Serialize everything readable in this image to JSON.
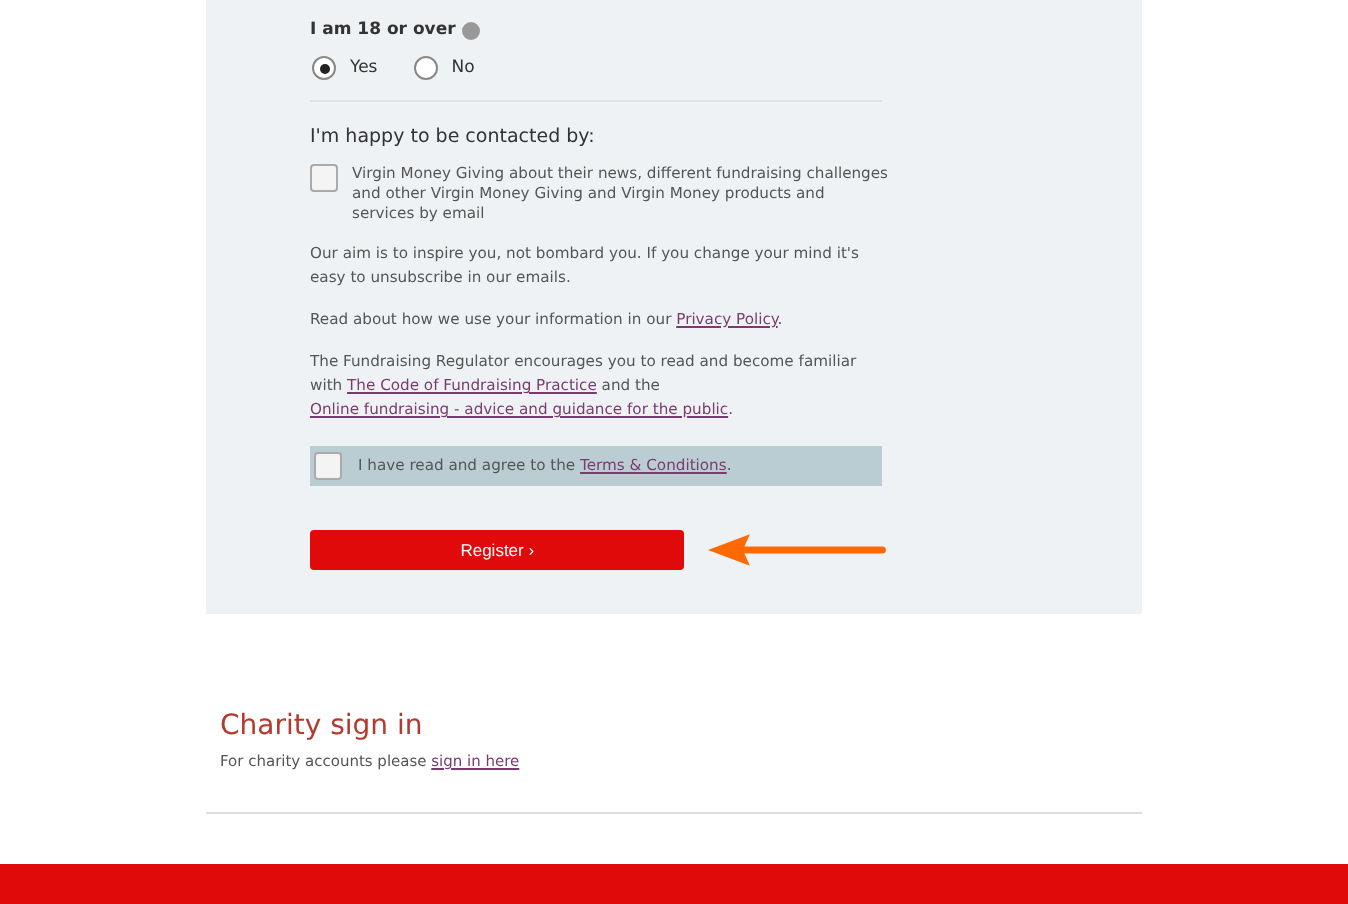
{
  "age_question": {
    "label": "I am 18 or over",
    "options": [
      {
        "label": "Yes",
        "selected": true
      },
      {
        "label": "No",
        "selected": false
      }
    ]
  },
  "contact": {
    "heading": "I'm happy to be contacted by:",
    "options": [
      {
        "label": "Virgin Money Giving about their news, different fundraising challenges and other Virgin Money Giving and Virgin Money products and services by email",
        "checked": false
      }
    ]
  },
  "paragraphs": [
    [
      {
        "kind": "text",
        "text": "Our aim is to inspire you, not bombard you. If you change your mind it's easy to unsubscribe in our emails."
      }
    ],
    [
      {
        "kind": "text",
        "text": "Read about how we use your information in our "
      },
      {
        "kind": "link",
        "text": "Privacy Policy"
      },
      {
        "kind": "text",
        "text": "."
      }
    ],
    [
      {
        "kind": "text",
        "text": "The Fundraising Regulator encourages you to read and become familiar with "
      },
      {
        "kind": "link",
        "text": "The Code of Fundraising Practice"
      },
      {
        "kind": "text",
        "text": " and the "
      },
      {
        "kind": "link",
        "text": "Online fundraising - advice and guidance for the public"
      },
      {
        "kind": "text",
        "text": "."
      }
    ]
  ],
  "terms": {
    "checked": false,
    "parts": [
      {
        "kind": "text",
        "text": "I have read and agree to the "
      },
      {
        "kind": "link",
        "text": "Terms & Conditions"
      },
      {
        "kind": "text",
        "text": "."
      }
    ]
  },
  "register_button": {
    "label": "Register",
    "chevron": "›"
  },
  "charity": {
    "heading": "Charity sign in",
    "parts": [
      {
        "kind": "text",
        "text": "For charity accounts please "
      },
      {
        "kind": "link",
        "text": "sign in here"
      }
    ]
  }
}
